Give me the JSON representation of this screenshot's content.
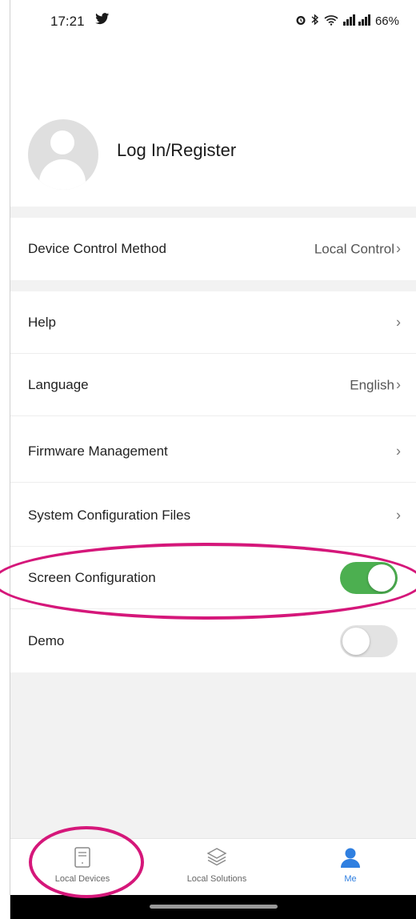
{
  "status_bar": {
    "time": "17:21",
    "battery": "66%"
  },
  "profile": {
    "login_label": "Log In/Register"
  },
  "settings": {
    "device_control_method": {
      "label": "Device Control Method",
      "value": "Local Control"
    },
    "help": {
      "label": "Help"
    },
    "language": {
      "label": "Language",
      "value": "English"
    },
    "firmware_management": {
      "label": "Firmware Management"
    },
    "system_configuration_files": {
      "label": "System Configuration Files"
    },
    "screen_configuration": {
      "label": "Screen Configuration",
      "enabled": true
    },
    "demo": {
      "label": "Demo",
      "enabled": false
    }
  },
  "chevron": "›",
  "tab_bar": {
    "tabs": [
      {
        "label": "Local Devices",
        "icon": "document-icon",
        "active": false
      },
      {
        "label": "Local Solutions",
        "icon": "layers-icon",
        "active": false
      },
      {
        "label": "Me",
        "icon": "person-icon",
        "active": true
      }
    ]
  },
  "colors": {
    "toggle_on": "#4caf50",
    "toggle_off": "#e3e3e3",
    "active_tab": "#2f7fe0",
    "annotation": "#d5177a"
  }
}
